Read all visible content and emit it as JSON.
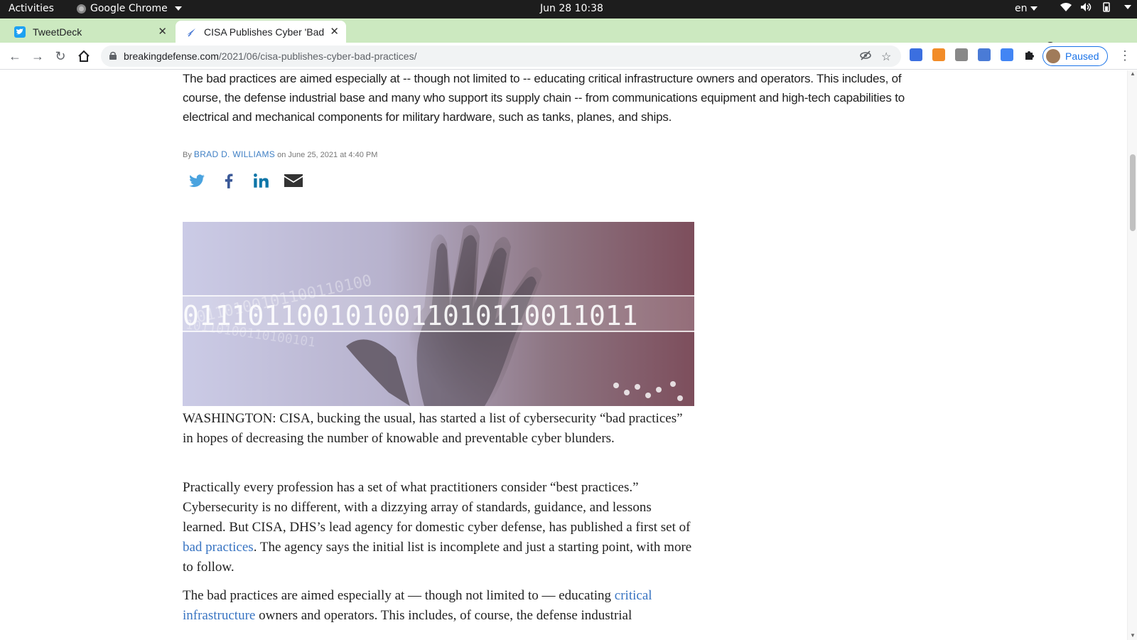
{
  "topbar": {
    "activities": "Activities",
    "app_name": "Google Chrome",
    "clock": "Jun 28  10:38",
    "lang": "en"
  },
  "tabs": [
    {
      "title": "TweetDeck",
      "favicon": "twitter-bird-icon"
    },
    {
      "title": "CISA Publishes Cyber 'Bad",
      "favicon": "breaking-defense-icon"
    }
  ],
  "toolbar": {
    "url_host": "breakingdefense.com",
    "url_path": "/2021/06/cisa-publishes-cyber-bad-practices/",
    "profile_label": "Paused"
  },
  "article": {
    "dek": "The bad practices are aimed especially at -- though not limited to -- educating critical infrastructure owners and operators. This includes, of course, the defense industrial base and many who support its supply chain -- from communications equipment and high-tech capabilities to electrical and mechanical components for military hardware, such as tanks, planes, and ships.",
    "by_label": "By",
    "author": "BRAD D. WILLIAMS",
    "date": "on June 25, 2021 at 4:40 PM",
    "hero_binary": "0111011001010011010110011011",
    "p1": "WASHINGTON: CISA, bucking the usual, has started a list of cybersecurity “bad practices” in hopes of decreasing the number of knowable and preventable cyber blunders.",
    "p2_before": "Practically every profession has a set of what practitioners consider “best practices.” Cybersecurity is no different, with a dizzying array of standards, guidance, and lessons learned. But CISA, DHS’s lead agency for domestic cyber defense, has published a first set of ",
    "p2_link": "bad practices",
    "p2_after": ". The agency says the initial list is incomplete and just a starting point, with more to follow.",
    "p3_before": "The bad practices are aimed especially at — though not limited to — educating ",
    "p3_link": "critical infrastructure",
    "p3_after": " owners and operators. This includes, of course, the defense industrial"
  },
  "colors": {
    "tabstrip": "#cce9c0",
    "link": "#3874c2",
    "author": "#3f7fc4"
  }
}
